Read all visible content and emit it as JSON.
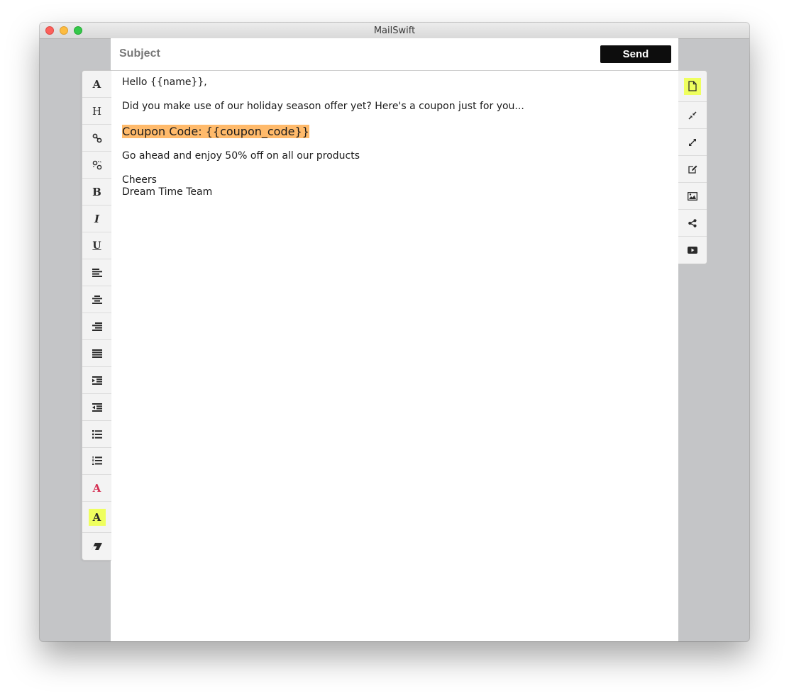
{
  "window": {
    "title": "MailSwift"
  },
  "subject": {
    "placeholder": "Subject"
  },
  "send": {
    "label": "Send"
  },
  "colors": {
    "send_bg": "#0d0d0d",
    "highlight": "#efff5e",
    "coupon_highlight": "#ffba6b",
    "text_color_icon": "#d42e52"
  },
  "body": {
    "line1": "Hello {{name}},",
    "line2": "Did you make use of our holiday season offer yet? Here's a coupon just for you...",
    "coupon": "Coupon Code: {{coupon_code}}",
    "line4": "Go ahead and enjoy 50% off on all our products",
    "line5": "Cheers",
    "line6": "Dream Time Team"
  },
  "left_toolbar": {
    "items": [
      {
        "icon": "font-family-icon",
        "glyph": "A"
      },
      {
        "icon": "heading-icon",
        "glyph": "H"
      },
      {
        "icon": "link-icon"
      },
      {
        "icon": "unlink-icon"
      },
      {
        "icon": "bold-icon",
        "glyph": "B"
      },
      {
        "icon": "italic-icon",
        "glyph": "I"
      },
      {
        "icon": "underline-icon",
        "glyph": "U"
      },
      {
        "icon": "align-left-icon"
      },
      {
        "icon": "align-center-icon"
      },
      {
        "icon": "align-right-icon"
      },
      {
        "icon": "align-justify-icon"
      },
      {
        "icon": "indent-icon"
      },
      {
        "icon": "outdent-icon"
      },
      {
        "icon": "bullet-list-icon"
      },
      {
        "icon": "numbered-list-icon"
      },
      {
        "icon": "text-color-icon",
        "glyph": "A"
      },
      {
        "icon": "highlight-color-icon",
        "glyph": "A",
        "active": true
      },
      {
        "icon": "eraser-icon"
      }
    ]
  },
  "right_toolbar": {
    "items": [
      {
        "icon": "new-document-icon",
        "active": true
      },
      {
        "icon": "compress-icon"
      },
      {
        "icon": "expand-icon"
      },
      {
        "icon": "edit-icon"
      },
      {
        "icon": "image-icon"
      },
      {
        "icon": "share-icon"
      },
      {
        "icon": "video-icon"
      }
    ]
  }
}
